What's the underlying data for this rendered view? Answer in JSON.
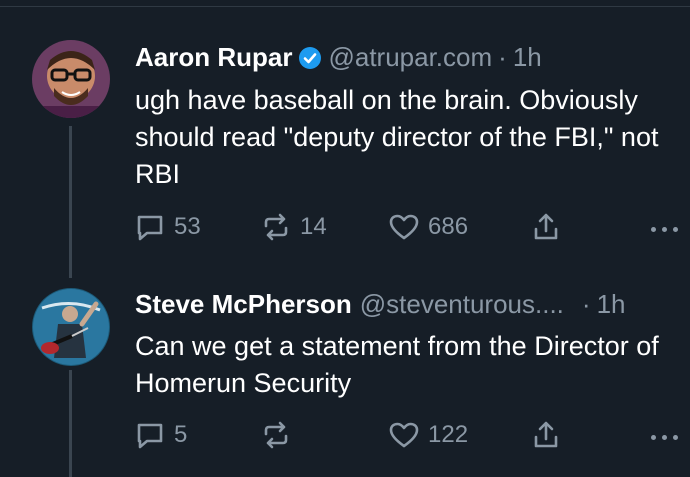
{
  "posts": [
    {
      "author_name": "Aaron Rupar",
      "verified": true,
      "handle": "@atrupar.com",
      "separator": "·",
      "time": "1h",
      "text": "ugh have baseball on the brain. Obviously should read \"deputy director of the FBI,\" not RBI",
      "replies": "53",
      "reposts": "14",
      "likes": "686"
    },
    {
      "author_name": "Steve McPherson",
      "verified": false,
      "handle": "@steventurous....",
      "separator": "·",
      "time": "1h",
      "text": "Can we get a statement from the Director of Homerun Security",
      "replies": "5",
      "reposts": "",
      "likes": "122"
    }
  ],
  "icons": {
    "reply": "reply-icon",
    "repost": "repost-icon",
    "like": "heart-icon",
    "share": "share-icon",
    "more": "more-dots-icon",
    "verified": "verified-badge-icon"
  },
  "colors": {
    "background": "#161e27",
    "text": "#ffffff",
    "muted": "#8b98a5",
    "verified": "#1d9bf0",
    "thread_line": "#3a4550"
  }
}
